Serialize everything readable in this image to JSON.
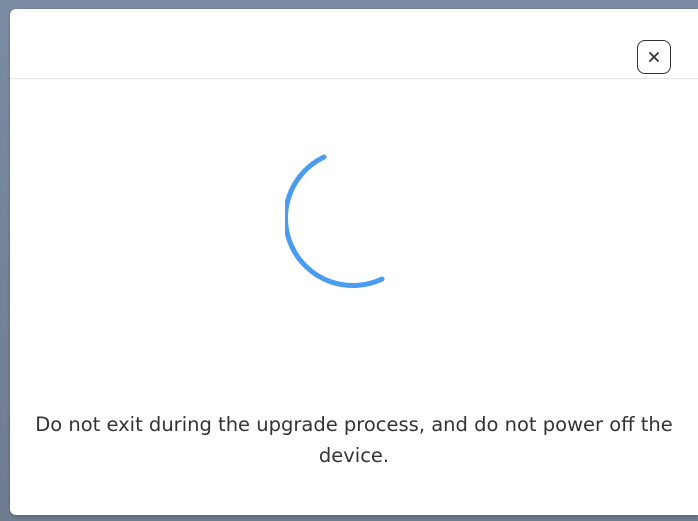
{
  "dialog": {
    "close_label": "×",
    "message": "Do not exit during the upgrade process, and do not power off the device."
  },
  "spinner": {
    "color": "#4a9cf0",
    "state": "loading"
  },
  "colors": {
    "backdrop": "#6f7f95",
    "dialog_background": "#ffffff",
    "text": "#333333"
  }
}
